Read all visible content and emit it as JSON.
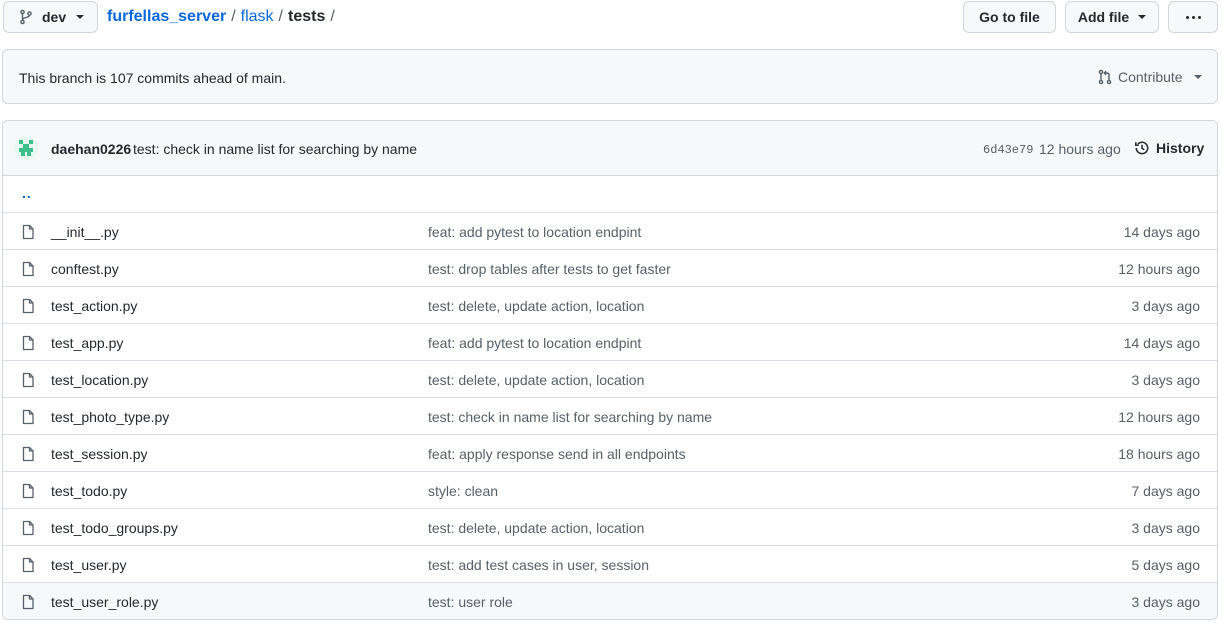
{
  "branch": {
    "name": "dev"
  },
  "breadcrumb": {
    "repo": "furfellas_server",
    "folder": "flask",
    "current": "tests",
    "separator": "/"
  },
  "actions": {
    "go_to_file": "Go to file",
    "add_file": "Add file",
    "more_icon": "kebab-horizontal-icon"
  },
  "branch_info": {
    "message": "This branch is 107 commits ahead of main.",
    "contribute": "Contribute"
  },
  "latest_commit": {
    "author": "daehan0226",
    "message": "test: check in name list for searching by name",
    "sha": "6d43e79",
    "time": "12 hours ago",
    "history_label": "History"
  },
  "parent_dir": "..",
  "files": [
    {
      "name": "__init__.py",
      "message": "feat: add pytest to location endpint",
      "age": "14 days ago"
    },
    {
      "name": "conftest.py",
      "message": "test: drop tables after tests to get faster",
      "age": "12 hours ago"
    },
    {
      "name": "test_action.py",
      "message": "test: delete, update action, location",
      "age": "3 days ago"
    },
    {
      "name": "test_app.py",
      "message": "feat: add pytest to location endpint",
      "age": "14 days ago"
    },
    {
      "name": "test_location.py",
      "message": "test: delete, update action, location",
      "age": "3 days ago"
    },
    {
      "name": "test_photo_type.py",
      "message": "test: check in name list for searching by name",
      "age": "12 hours ago"
    },
    {
      "name": "test_session.py",
      "message": "feat: apply response send in all endpoints",
      "age": "18 hours ago"
    },
    {
      "name": "test_todo.py",
      "message": "style: clean",
      "age": "7 days ago"
    },
    {
      "name": "test_todo_groups.py",
      "message": "test: delete, update action, location",
      "age": "3 days ago"
    },
    {
      "name": "test_user.py",
      "message": "test: add test cases in user, session",
      "age": "5 days ago"
    },
    {
      "name": "test_user_role.py",
      "message": "test: user role",
      "age": "3 days ago"
    }
  ],
  "colors": {
    "link": "#0969da",
    "text": "#24292f",
    "muted": "#57606a",
    "border": "#d0d7de",
    "canvas_subtle": "#f6f8fa"
  }
}
